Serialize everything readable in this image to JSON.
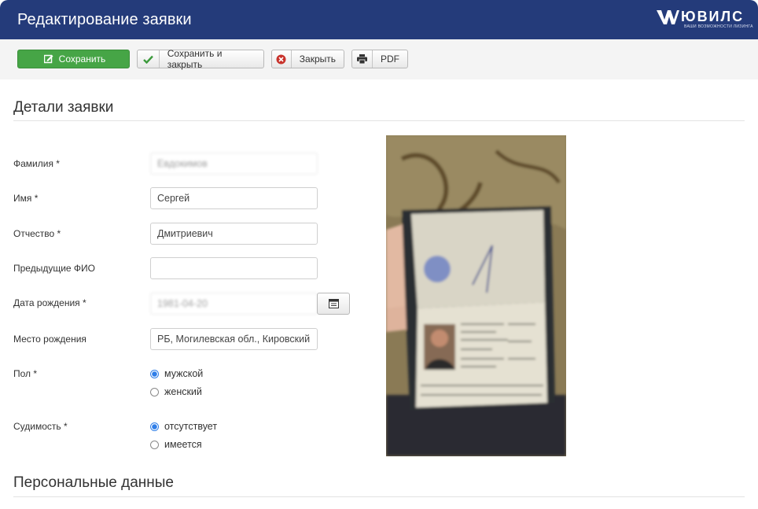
{
  "header": {
    "title": "Редактирование заявки",
    "logo_name": "ЮВИЛС",
    "logo_tagline": "ВАШИ ВОЗМОЖНОСТИ ЛИЗИНГА"
  },
  "toolbar": {
    "save_label": "Сохранить",
    "save_close_label": "Сохранить и закрыть",
    "close_label": "Закрыть",
    "pdf_label": "PDF"
  },
  "sections": {
    "details_title": "Детали заявки",
    "personal_title": "Персональные данные"
  },
  "form": {
    "surname": {
      "label": "Фамилия *",
      "value": "Евдокимов"
    },
    "name": {
      "label": "Имя *",
      "value": "Сергей"
    },
    "patronymic": {
      "label": "Отчество *",
      "value": "Дмитриевич"
    },
    "previous_name": {
      "label": "Предыдущие ФИО",
      "value": ""
    },
    "birth_date": {
      "label": "Дата рождения *",
      "value": "1981-04-20"
    },
    "birth_place": {
      "label": "Место рождения",
      "value": "РБ, Могилевская обл., Кировский"
    },
    "gender": {
      "label": "Пол *",
      "options": [
        "мужской",
        "женский"
      ],
      "selected": "мужской"
    },
    "criminal_record": {
      "label": "Судимость *",
      "options": [
        "отсутствует",
        "имеется"
      ],
      "selected": "отсутствует"
    }
  },
  "colors": {
    "header": "#243b7a",
    "save_button": "#46a546",
    "radio_selected": "#2f7ee8"
  }
}
